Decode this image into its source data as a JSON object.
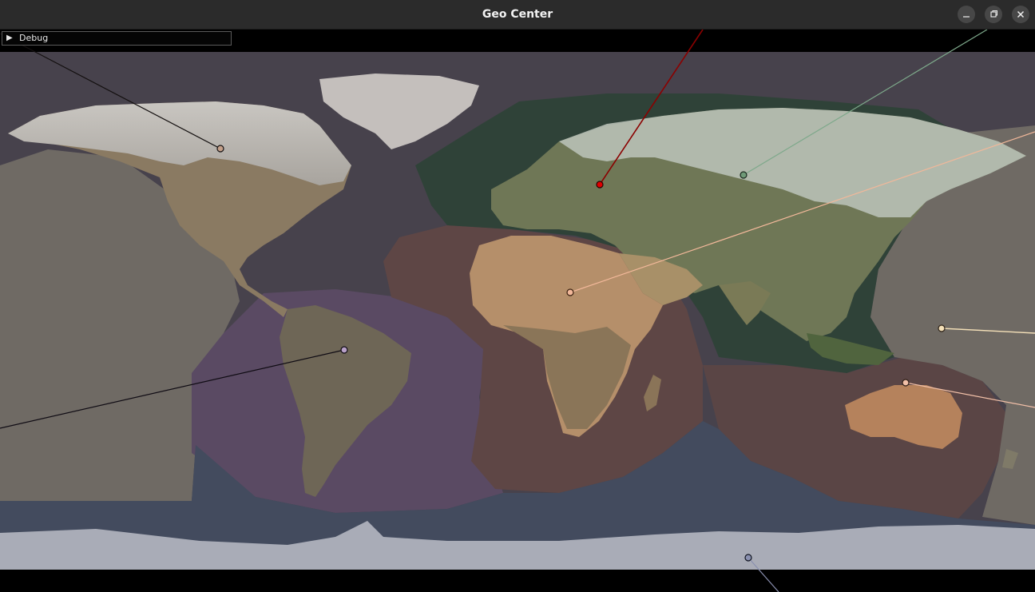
{
  "window": {
    "title": "Geo Center",
    "buttons": [
      {
        "name": "minimize",
        "icon": "minimize-icon"
      },
      {
        "name": "maximize",
        "icon": "maximize-icon"
      },
      {
        "name": "close",
        "icon": "close-icon"
      }
    ]
  },
  "debug_panel": {
    "label": "Debug",
    "expand_icon": "triangle-right-icon",
    "collapsed": true
  },
  "map": {
    "projection": "equirectangular",
    "background_color": "#000000",
    "ocean_color": "#47424c",
    "regions": [
      {
        "name": "north-america",
        "color": "#6a5e5a"
      },
      {
        "name": "north-pacific",
        "color": "#4a4550"
      },
      {
        "name": "south-america",
        "color": "#5a4a63"
      },
      {
        "name": "africa",
        "color": "#5e4645"
      },
      {
        "name": "eurasia",
        "color": "#2f4238"
      },
      {
        "name": "oceania",
        "color": "#5a4545"
      },
      {
        "name": "southern-ocean",
        "color": "#434b5e"
      },
      {
        "name": "antarctica",
        "color": "#a9acb7"
      },
      {
        "name": "pacific-east",
        "color": "#6f6a64"
      }
    ],
    "centers": [
      {
        "name": "north-america",
        "color": "#c4a08a"
      },
      {
        "name": "europe",
        "color": "#e00000"
      },
      {
        "name": "asia",
        "color": "#6f9a78"
      },
      {
        "name": "africa",
        "color": "#f2b89a"
      },
      {
        "name": "south-america",
        "color": "#b8a0c8"
      },
      {
        "name": "oceania",
        "color": "#f4e0b8"
      },
      {
        "name": "australia",
        "color": "#f2c0a8"
      },
      {
        "name": "antarctica",
        "color": "#8a90b0"
      }
    ]
  }
}
